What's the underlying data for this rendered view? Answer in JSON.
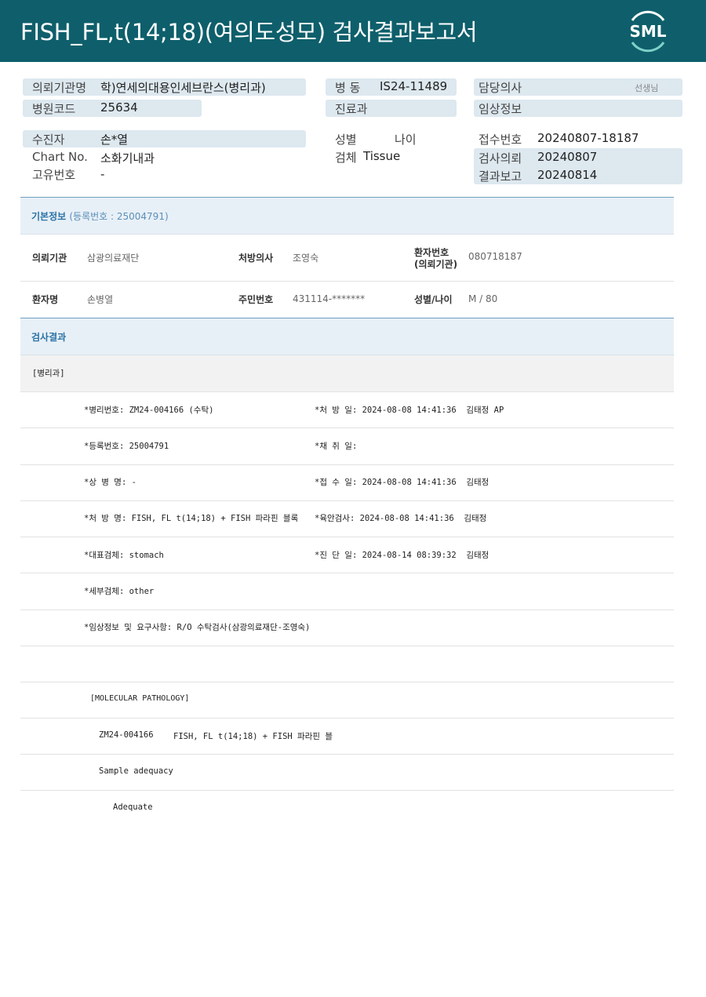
{
  "header": {
    "title": "FISH_FL,t(14;18)(여의도성모) 검사결과보고서",
    "logo_text": "SML"
  },
  "info": {
    "requester_label": "의뢰기관명",
    "requester_value": "학)연세의대용인세브란스(병리과)",
    "ward_label": "병  동",
    "ward_value": "IS24-11489",
    "doctor_label": "담당의사",
    "doctor_suffix": "선생님",
    "hospital_code_label": "병원코드",
    "hospital_code_value": "25634",
    "dept_label": "진료과",
    "clinical_label": "임상정보",
    "patient_label": "수진자",
    "patient_value": "손*열",
    "sex_label": "성별",
    "age_label": "나이",
    "receipt_label": "접수번호",
    "receipt_value": "20240807-18187",
    "chart_label": "Chart No.",
    "chart_value": "소화기내과",
    "specimen_label": "검체",
    "specimen_value": "Tissue",
    "request_date_label": "검사의뢰",
    "request_date_value": "20240807",
    "unique_label": "고유번호",
    "unique_value": "-",
    "report_date_label": "결과보고",
    "report_date_value": "20240814"
  },
  "basic": {
    "title": "기본정보",
    "reg": "(등록번호 : 25004791)",
    "inst_label": "의뢰기관",
    "inst_value": "삼광의료재단",
    "presc_label": "처방의사",
    "presc_value": "조영숙",
    "pno_label_1": "환자번호",
    "pno_label_2": "(의뢰기관)",
    "pno_value": "080718187",
    "name_label": "환자명",
    "name_value": "손병열",
    "rrn_label": "주민번호",
    "rrn_value": "431114-*******",
    "sexage_label": "성별/나이",
    "sexage_value": "M / 80"
  },
  "result": {
    "title": "검사결과",
    "dept_tag": "[병리과]",
    "lines": {
      "l1a": "*병리번호: ZM24-004166 (수탁)",
      "l1b": "*처 방 일: 2024-08-08 14:41:36  김태정 AP",
      "l2a": "*등록번호: 25004791",
      "l2b": "*채 취 일:",
      "l3a": "*상 병 명: -",
      "l3b": "*접 수 일: 2024-08-08 14:41:36  김태정",
      "l4a": "*처 방 명: FISH, FL t(14;18) + FISH 파라핀 블록",
      "l4b": "*육안검사: 2024-08-08 14:41:36  김태정",
      "l5a": "*대표검체: stomach",
      "l5b": "*진 단 일: 2024-08-14 08:39:32  김태정",
      "l6a": "*세부검체: other",
      "l7a": "*임상정보 및 요구사항: R/O 수탁검사(삼광의료재단-조영숙)",
      "mp_title": "[MOLECULAR PATHOLOGY]",
      "mp_id": "ZM24-004166",
      "mp_test": "FISH, FL t(14;18) + FISH 파라핀 블",
      "mp_sample": "Sample adequacy",
      "mp_adequate": "Adequate"
    }
  },
  "colors": {
    "header": "#0e5f6b",
    "box": "#dde8ef",
    "section": "#e8f0f7"
  }
}
